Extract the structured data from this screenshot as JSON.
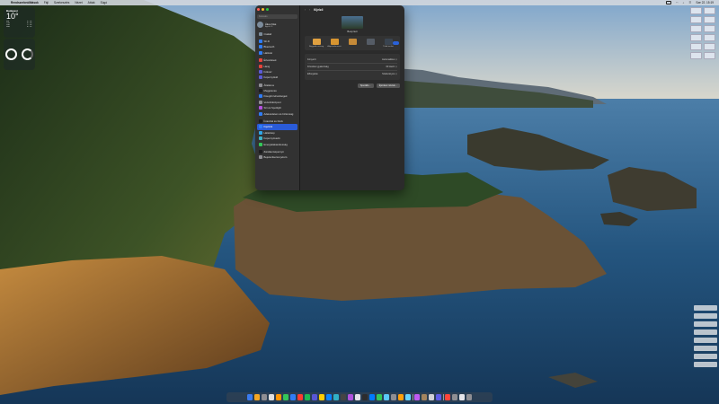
{
  "menubar": {
    "apple": "",
    "app_name": "Rendszerbeállítások",
    "menus": [
      "Fájl",
      "Szerkesztés",
      "Nézet",
      "Ablak",
      "Súgó"
    ],
    "clock": "Sze 22. 15:19"
  },
  "weather": {
    "city": "Budapest",
    "temp": "10°",
    "rows": [
      {
        "day": "Ma",
        "range": "5° 13°"
      },
      {
        "day": "Csü",
        "range": "6° 14°"
      },
      {
        "day": "Pén",
        "range": "7° 15°"
      },
      {
        "day": "Szo",
        "range": "6° 12°"
      }
    ]
  },
  "window": {
    "title": "Kijelző",
    "search_placeholder": "Keresés",
    "account": {
      "name": "Ákos Kiss",
      "sub": "Apple ID"
    },
    "family": "Család",
    "sidebar_groups": [
      [
        {
          "label": "Wi-Fi",
          "color": "#2f7cf6"
        },
        {
          "label": "Bluetooth",
          "color": "#2f7cf6"
        },
        {
          "label": "Hálózat",
          "color": "#2f7cf6"
        }
      ],
      [
        {
          "label": "Értesítések",
          "color": "#e5443b"
        },
        {
          "label": "Hang",
          "color": "#e5443b"
        },
        {
          "label": "Fókusz",
          "color": "#5b5bd6"
        },
        {
          "label": "Képernyőidő",
          "color": "#5b5bd6"
        }
      ],
      [
        {
          "label": "Általános",
          "color": "#8e8e93"
        },
        {
          "label": "Megjelenés",
          "color": "#1c1c1e"
        },
        {
          "label": "Kisegítő lehetőségek",
          "color": "#2f7cf6"
        },
        {
          "label": "Vezérlőközpont",
          "color": "#8e8e93"
        },
        {
          "label": "Siri és Spotlight",
          "color": "#b44fe0"
        },
        {
          "label": "Adatvédelem és biztonság",
          "color": "#2f7cf6"
        }
      ],
      [
        {
          "label": "Íróasztal és Dock",
          "color": "#1c1c1e"
        },
        {
          "label": "Kijelzők",
          "color": "#2f7cf6",
          "selected": true
        },
        {
          "label": "Háttérkép",
          "color": "#2fa6e8"
        },
        {
          "label": "Képernyővédő",
          "color": "#3fb2c9"
        },
        {
          "label": "Energiatakarékosság",
          "color": "#34c759"
        }
      ],
      [
        {
          "label": "Zárolási képernyő",
          "color": "#1c1c1e"
        },
        {
          "label": "Bejelentkezési jelszó",
          "color": "#8e8e93"
        }
      ]
    ],
    "display_name": "Beépített",
    "modes": [
      {
        "label": "Nagyobb szöveg",
        "color": "#e0a040"
      },
      {
        "label": "Alapértelmezett",
        "color": "#d89530"
      },
      {
        "label": "",
        "color": "#c58a38"
      },
      {
        "label": "",
        "color": "#555c66"
      },
      {
        "label": "Több terület",
        "color": "#3a4450"
      }
    ],
    "rows": [
      {
        "label": "Fényerő",
        "value": "Automatikus ◇"
      },
      {
        "label": "Frissítési gyakoriság",
        "value": "60 Hertz ◇"
      },
      {
        "label": "Elforgatás",
        "value": "Szabványos ◇"
      }
    ],
    "buttons": [
      "Speciális…",
      "Éjszakai műszak…"
    ]
  },
  "dock_colors": [
    "#3a7bf0",
    "#f5a623",
    "#8e8e93",
    "#e0e0e0",
    "#ff9500",
    "#34c759",
    "#2f7cf6",
    "#ff3b30",
    "#1db954",
    "#5856d6",
    "#ffcc00",
    "#0a84ff",
    "#30b0c7",
    "#444444",
    "#af52de",
    "#e5e5ea",
    "#2c2c2e",
    "#007aff",
    "#34c759",
    "#5ac8fa",
    "#8e8e93",
    "#ff9f0a",
    "#64d2ff",
    "#bf5af2",
    "#a2845e",
    "#d1d1d6",
    "#5e5ce6",
    "#ff453a",
    "#8e8e93",
    "#e5e5ea",
    "#8e8e93"
  ]
}
